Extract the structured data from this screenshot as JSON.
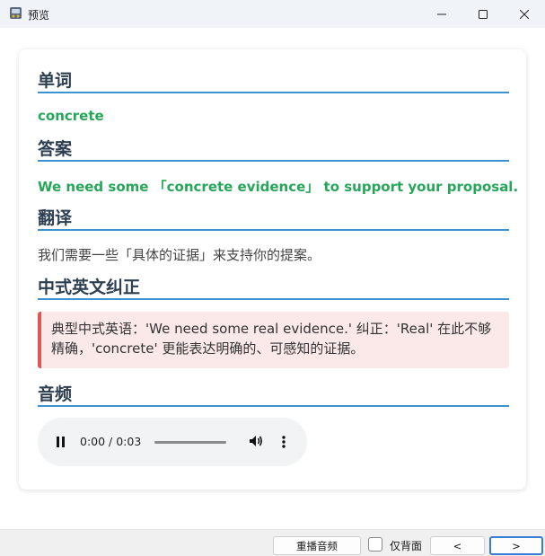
{
  "window": {
    "title": "预览",
    "icon": "app-icon"
  },
  "sections": {
    "word_heading": "单词",
    "answer_heading": "答案",
    "translation_heading": "翻译",
    "chinglish_heading": "中式英文纠正",
    "audio_heading": "音频"
  },
  "word": "concrete",
  "answer": "We need some 「concrete evidence」 to support your proposal.",
  "translation": "我们需要一些「具体的证据」来支持你的提案。",
  "correction": {
    "line1": "典型中式英语：'We need some real evidence.' 纠正：'Real' 在此不够",
    "line2": "精确，'concrete' 更能表达明确的、可感知的证据。"
  },
  "audio": {
    "time": "0:00 / 0:03",
    "progress": 0.0,
    "state": "playing"
  },
  "bottom": {
    "replay_label": "重播音频",
    "checkbox_label": "仅背面",
    "checkbox_checked": false,
    "prev_label": "<",
    "next_label": ">"
  },
  "colors": {
    "accent_line": "#3a93d0",
    "green_text": "#27a65a",
    "correction_bg": "#fbe9e9",
    "correction_border": "#e05555"
  }
}
